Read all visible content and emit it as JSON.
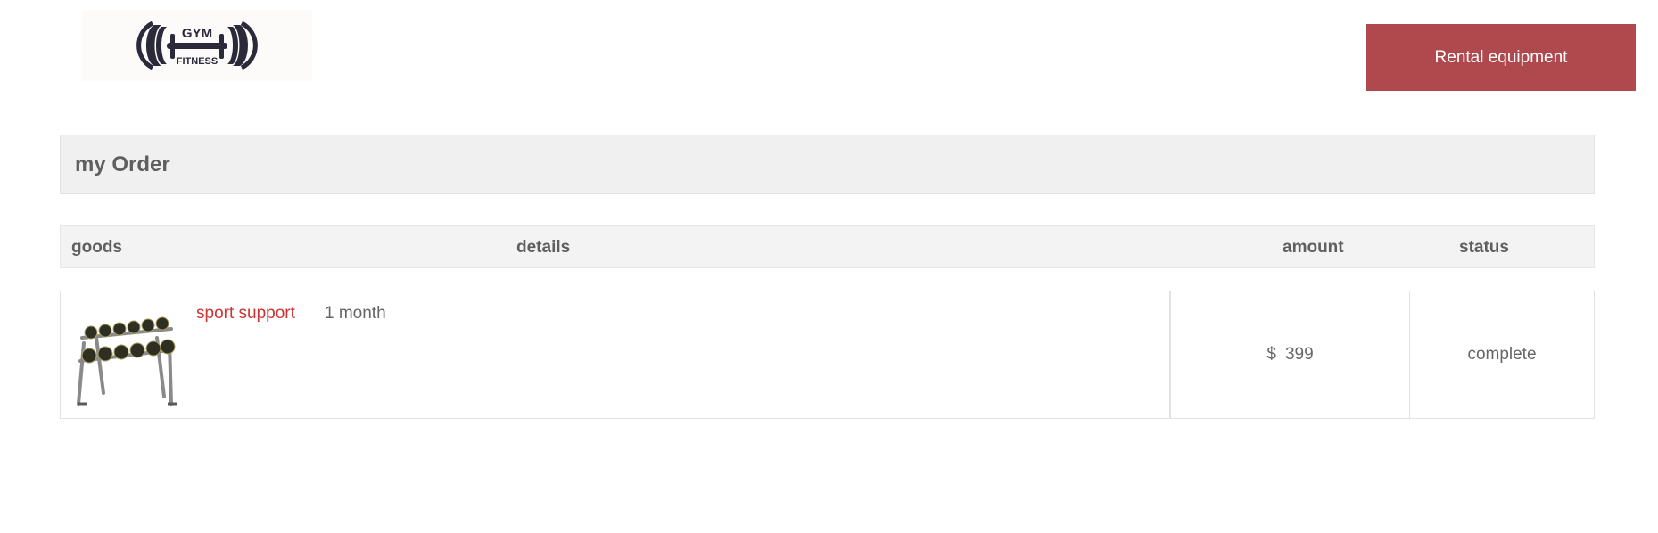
{
  "header": {
    "logo": {
      "line1": "GYM",
      "line2": "FITNESS",
      "icon": "barbell-icon"
    },
    "rental_button_label": "Rental equipment"
  },
  "page_title": "my Order",
  "columns": {
    "goods": "goods",
    "details": "details",
    "amount": "amount",
    "status": "status"
  },
  "orders": [
    {
      "image": "dumbbell-rack-image",
      "name": "sport support",
      "duration": "1 month",
      "currency": "$",
      "amount": "399",
      "status": "complete"
    }
  ],
  "colors": {
    "accent": "#b0494d",
    "link_red": "#cc3333",
    "text": "#666666"
  }
}
